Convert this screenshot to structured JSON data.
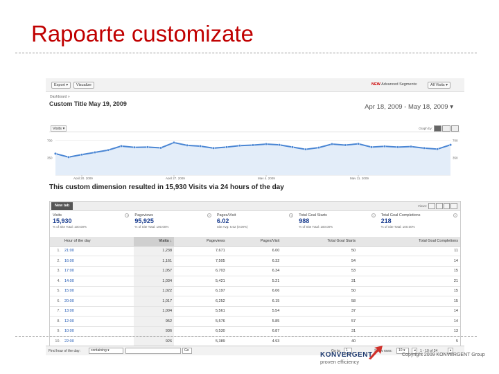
{
  "slide": {
    "title": "Rapoarte customizate",
    "copyright": "Copyright 2009 KONVERGENT Group",
    "logo_name": "KONVERGENT",
    "logo_tagline": "proven efficiency"
  },
  "toolbar": {
    "export_label": "Export ▾",
    "visualize_label": "Visualize",
    "new_badge": "NEW",
    "advanced_segments_label": "Advanced Segments:",
    "segment_value": "All Visits ▾"
  },
  "report": {
    "dashboard_link": "Dashboard »",
    "title": "Custom Title May 19, 2009",
    "date_range": "Apr 18, 2009 - May 18, 2009 ▾",
    "metric_select": "Visits ▾",
    "graph_by_label": "Graph by:",
    "summary_line": "This custom dimension resulted in 15,930 Visits via 24 hours of the day"
  },
  "chart_data": {
    "type": "line",
    "x": [
      "Apr 18",
      "Apr 19",
      "Apr 20",
      "Apr 21",
      "Apr 22",
      "Apr 23",
      "Apr 24",
      "Apr 25",
      "Apr 26",
      "Apr 27",
      "Apr 28",
      "Apr 29",
      "Apr 30",
      "May 1",
      "May 2",
      "May 3",
      "May 4",
      "May 5",
      "May 6",
      "May 7",
      "May 8",
      "May 9",
      "May 10",
      "May 11",
      "May 12",
      "May 13",
      "May 14",
      "May 15",
      "May 16",
      "May 17",
      "May 18"
    ],
    "series": [
      {
        "values": [
          430,
          360,
          410,
          455,
          500,
          580,
          555,
          560,
          545,
          650,
          595,
          580,
          540,
          560,
          590,
          600,
          620,
          605,
          560,
          515,
          550,
          620,
          600,
          625,
          560,
          575,
          560,
          570,
          540,
          520,
          605
        ]
      }
    ],
    "yticks": [
      "700",
      "350"
    ],
    "ylim": [
      0,
      800
    ],
    "xtick_labels": [
      "April 20, 2009",
      "April 27, 2009",
      "May 4, 2009",
      "May 11, 2009"
    ],
    "color": "#4a86d4",
    "grid": true
  },
  "table_panel": {
    "tab_label": "New tab",
    "views_label": "Views:",
    "scorecards": [
      {
        "label": "Visits",
        "value": "15,930",
        "sub": "% of Site Total: 100.00%"
      },
      {
        "label": "Pageviews",
        "value": "95,925",
        "sub": "% of Site Total: 100.00%"
      },
      {
        "label": "Pages/Visit",
        "value": "6.02",
        "sub": "Site Avg: 6.02 (0.00%)"
      },
      {
        "label": "Total Goal Starts",
        "value": "988",
        "sub": "% of Site Total: 100.00%"
      },
      {
        "label": "Total Goal Completions",
        "value": "218",
        "sub": "% of Site Total: 100.00%"
      }
    ],
    "columns": [
      "Hour of the day",
      "Visits ↓",
      "Pageviews",
      "Pages/Visit",
      "Total Goal Starts",
      "Total Goal Completions"
    ],
    "rows": [
      [
        "1.",
        "21:00",
        "1,238",
        "7,671",
        "6.00",
        "50",
        "11"
      ],
      [
        "2.",
        "16:00",
        "1,161",
        "7,505",
        "6.32",
        "54",
        "14"
      ],
      [
        "3.",
        "17:00",
        "1,057",
        "6,703",
        "6.34",
        "53",
        "15"
      ],
      [
        "4.",
        "14:00",
        "1,034",
        "5,421",
        "5.21",
        "31",
        "21"
      ],
      [
        "5.",
        "15:00",
        "1,022",
        "6,197",
        "6.06",
        "50",
        "15"
      ],
      [
        "6.",
        "20:00",
        "1,017",
        "6,252",
        "6.15",
        "58",
        "15"
      ],
      [
        "7.",
        "13:00",
        "1,004",
        "5,561",
        "5.54",
        "37",
        "14"
      ],
      [
        "8.",
        "12:00",
        "952",
        "5,576",
        "5.85",
        "57",
        "14"
      ],
      [
        "9.",
        "10:00",
        "936",
        "6,530",
        "6.87",
        "31",
        "13"
      ],
      [
        "10.",
        "22:00",
        "926",
        "5,389",
        "4.93",
        "40",
        "5"
      ]
    ],
    "footer": {
      "find_label": "Find hour of the day:",
      "filter_mode": "containing ▾",
      "go_label": "Go",
      "goto_label": "Go to:",
      "goto_value": "1",
      "show_rows_label": "Show rows:",
      "show_rows_value": "10 ▾",
      "range_text": "1 - 10 of 24",
      "prev_icon": "◂",
      "next_icon": "▸"
    }
  }
}
